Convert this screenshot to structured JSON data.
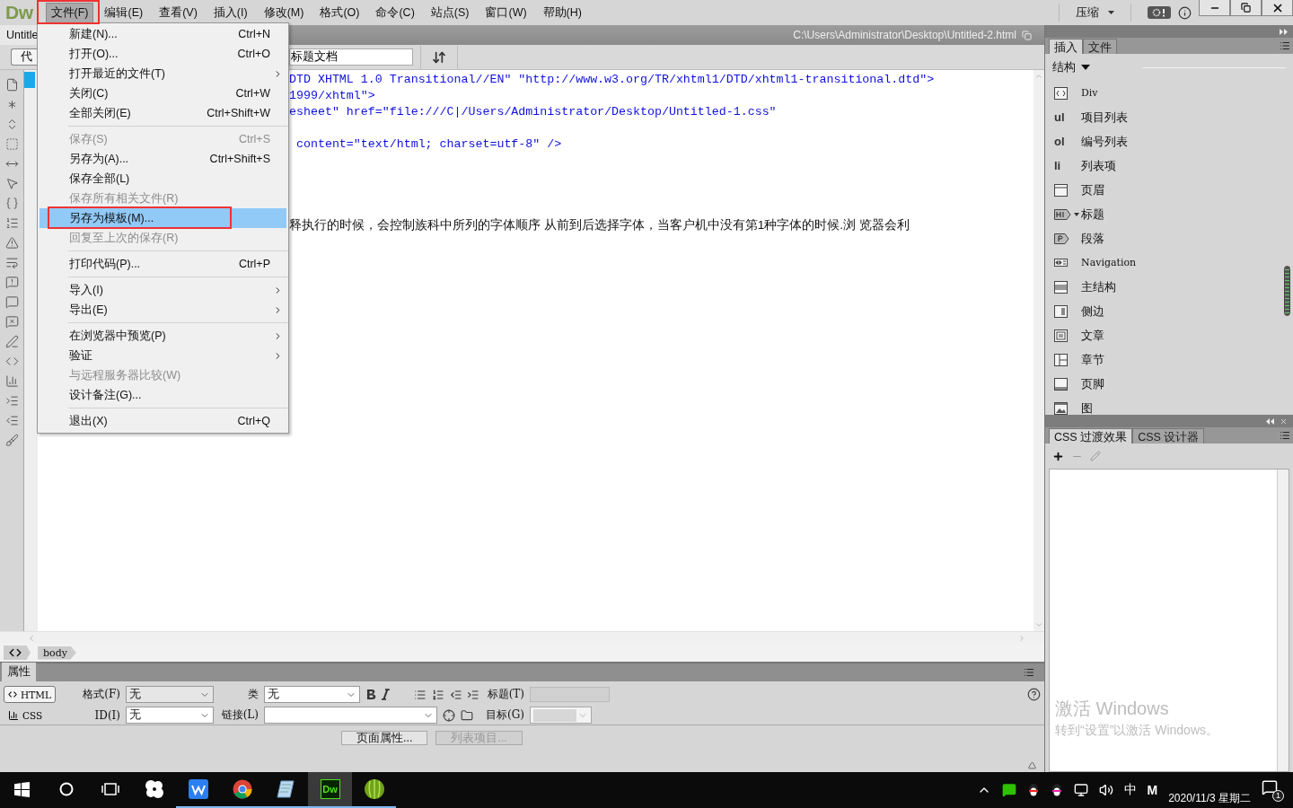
{
  "menubar": {
    "logo": "Dw",
    "items": [
      {
        "label": "文件(F)",
        "selected": true
      },
      {
        "label": "编辑(E)",
        "selected": false
      },
      {
        "label": "查看(V)",
        "selected": false
      },
      {
        "label": "插入(I)",
        "selected": false
      },
      {
        "label": "修改(M)",
        "selected": false
      },
      {
        "label": "格式(O)",
        "selected": false
      },
      {
        "label": "命令(C)",
        "selected": false
      },
      {
        "label": "站点(S)",
        "selected": false
      },
      {
        "label": "窗口(W)",
        "selected": false
      },
      {
        "label": "帮助(H)",
        "selected": false
      }
    ],
    "workspace": "压缩"
  },
  "document": {
    "tab": "Untitle",
    "path": "C:\\Users\\Administrator\\Desktop\\Untitled-2.html",
    "view_button": "代",
    "title_field": "标题文档"
  },
  "code_lines": [
    {
      "kind": "markup",
      "text": "DTD XHTML 1.0 Transitional//EN\" \"http://www.w3.org/TR/xhtml1/DTD/xhtml1-transitional.dtd\">"
    },
    {
      "kind": "markup",
      "text": "1999/xhtml\">"
    },
    {
      "kind": "markup",
      "text": "esheet\" href=\"file:///C|/Users/Administrator/Desktop/Untitled-1.css\""
    },
    {
      "kind": "blank"
    },
    {
      "kind": "markup",
      "text": " content=\"text/html; charset=utf-8\" />"
    },
    {
      "kind": "blank"
    },
    {
      "kind": "blank"
    },
    {
      "kind": "blank"
    },
    {
      "kind": "blank"
    },
    {
      "kind": "text",
      "text": "释执行的时候，会控制族科中所列的字体顺序 从前到后选择字体，当客户机中没有第1种字体的时候.浏 览器会利"
    }
  ],
  "tag_selector": {
    "tags": [
      "body"
    ]
  },
  "file_menu": {
    "items": [
      {
        "kind": "item",
        "label": "新建(N)...",
        "shortcut": "Ctrl+N",
        "disabled": false,
        "submenu": false,
        "selected": false
      },
      {
        "kind": "item",
        "label": "打开(O)...",
        "shortcut": "Ctrl+O",
        "disabled": false,
        "submenu": false,
        "selected": false
      },
      {
        "kind": "item",
        "label": "打开最近的文件(T)",
        "disabled": false,
        "submenu": true,
        "selected": false
      },
      {
        "kind": "item",
        "label": "关闭(C)",
        "shortcut": "Ctrl+W",
        "disabled": false,
        "submenu": false,
        "selected": false
      },
      {
        "kind": "item",
        "label": "全部关闭(E)",
        "shortcut": "Ctrl+Shift+W",
        "disabled": false,
        "submenu": false,
        "selected": false
      },
      {
        "kind": "separator"
      },
      {
        "kind": "item",
        "label": "保存(S)",
        "shortcut": "Ctrl+S",
        "disabled": true,
        "submenu": false,
        "selected": false
      },
      {
        "kind": "item",
        "label": "另存为(A)...",
        "shortcut": "Ctrl+Shift+S",
        "disabled": false,
        "submenu": false,
        "selected": false
      },
      {
        "kind": "item",
        "label": "保存全部(L)",
        "disabled": false,
        "submenu": false,
        "selected": false
      },
      {
        "kind": "item",
        "label": "保存所有相关文件(R)",
        "disabled": true,
        "submenu": false,
        "selected": false
      },
      {
        "kind": "item",
        "label": "另存为模板(M)...",
        "disabled": false,
        "submenu": false,
        "selected": true
      },
      {
        "kind": "item",
        "label": "回复至上次的保存(R)",
        "disabled": true,
        "submenu": false,
        "selected": false
      },
      {
        "kind": "separator"
      },
      {
        "kind": "item",
        "label": "打印代码(P)...",
        "shortcut": "Ctrl+P",
        "disabled": false,
        "submenu": false,
        "selected": false
      },
      {
        "kind": "separator"
      },
      {
        "kind": "item",
        "label": "导入(I)",
        "disabled": false,
        "submenu": true,
        "selected": false
      },
      {
        "kind": "item",
        "label": "导出(E)",
        "disabled": false,
        "submenu": true,
        "selected": false
      },
      {
        "kind": "separator"
      },
      {
        "kind": "item",
        "label": "在浏览器中预览(P)",
        "disabled": false,
        "submenu": true,
        "selected": false
      },
      {
        "kind": "item",
        "label": "验证",
        "disabled": false,
        "submenu": true,
        "selected": false
      },
      {
        "kind": "item",
        "label": "与远程服务器比较(W)",
        "disabled": true,
        "submenu": false,
        "selected": false
      },
      {
        "kind": "item",
        "label": "设计备注(G)...",
        "disabled": false,
        "submenu": false,
        "selected": false
      },
      {
        "kind": "separator"
      },
      {
        "kind": "item",
        "label": "退出(X)",
        "shortcut": "Ctrl+Q",
        "disabled": false,
        "submenu": false,
        "selected": false
      }
    ]
  },
  "insert_panel": {
    "tabs": [
      {
        "label": "插入",
        "selected": true
      },
      {
        "label": "文件",
        "selected": false
      }
    ],
    "category": "结构",
    "items": [
      {
        "kind": "div",
        "label": "Div",
        "has_menu": false
      },
      {
        "kind": "glyph",
        "glyph": "ul",
        "label": "项目列表",
        "has_menu": false
      },
      {
        "kind": "glyph",
        "glyph": "ol",
        "label": "编号列表",
        "has_menu": false
      },
      {
        "kind": "glyph",
        "glyph": "li",
        "label": "列表项",
        "has_menu": false
      },
      {
        "kind": "header",
        "label": "页眉",
        "has_menu": false
      },
      {
        "kind": "heading",
        "label": "标题",
        "has_menu": true
      },
      {
        "kind": "paragraph",
        "label": "段落",
        "has_menu": false
      },
      {
        "kind": "nav",
        "label": "Navigation",
        "has_menu": false
      },
      {
        "kind": "main",
        "label": "主结构",
        "has_menu": false
      },
      {
        "kind": "aside",
        "label": "侧边",
        "has_menu": false
      },
      {
        "kind": "article",
        "label": "文章",
        "has_menu": false
      },
      {
        "kind": "section",
        "label": "章节",
        "has_menu": false
      },
      {
        "kind": "footer",
        "label": "页脚",
        "has_menu": false
      },
      {
        "kind": "figure",
        "label": "图",
        "has_menu": false
      }
    ]
  },
  "css_panel": {
    "tabs": [
      {
        "label": "CSS 过渡效果",
        "selected": true
      },
      {
        "label": "CSS 设计器",
        "selected": false
      }
    ]
  },
  "properties": {
    "title": "属性",
    "modes": [
      {
        "label": "HTML",
        "selected": true
      },
      {
        "label": "CSS",
        "selected": false
      }
    ],
    "format": {
      "label": "格式(F)",
      "value": "无"
    },
    "id": {
      "label": "ID(I)",
      "value": "无"
    },
    "class": {
      "label": "类",
      "value": "无"
    },
    "link": {
      "label": "链接(L)"
    },
    "title_field": {
      "label": "标题(T)",
      "disabled": true
    },
    "target": {
      "label": "目标(G)",
      "disabled": true
    },
    "buttons": [
      {
        "label": "页面属性...",
        "disabled": false
      },
      {
        "label": "列表项目...",
        "disabled": true
      }
    ]
  },
  "activation": {
    "title": "激活 Windows",
    "message": "转到“设置”以激活 Windows。"
  },
  "taskbar": {
    "apps": [
      {
        "kind": "pinwheel",
        "running": false,
        "selected": false
      },
      {
        "kind": "wps",
        "running": true,
        "selected": false
      },
      {
        "kind": "chrome",
        "running": true,
        "selected": false
      },
      {
        "kind": "notepad",
        "running": true,
        "selected": false
      },
      {
        "kind": "dw",
        "label": "Dw",
        "running": true,
        "selected": true
      },
      {
        "kind": "melon",
        "running": true,
        "selected": false
      }
    ],
    "ime": "中",
    "ime_mode": "M",
    "date": "2020/11/3 星期二",
    "notifications": "1"
  }
}
